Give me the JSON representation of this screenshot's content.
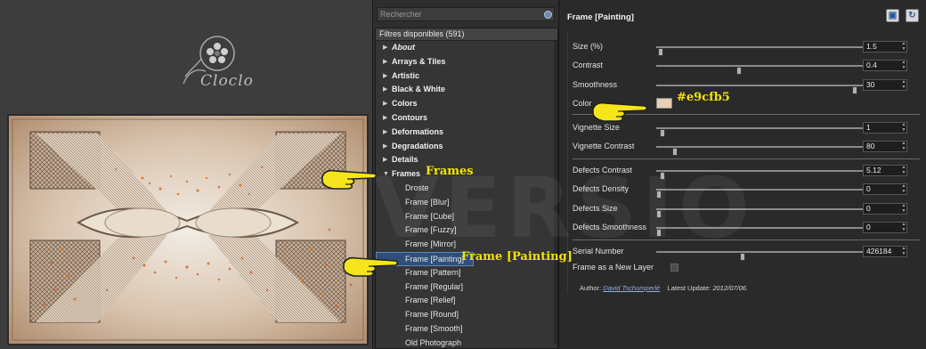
{
  "preview": {
    "logo_text": "Cloclo"
  },
  "filter_list": {
    "search_placeholder": "Rechercher",
    "header": "Filtres disponibles (591)",
    "categories": [
      "About",
      "Arrays & Tiles",
      "Artistic",
      "Black & White",
      "Colors",
      "Contours",
      "Deformations",
      "Degradations",
      "Details",
      "Frames"
    ],
    "frames_items": [
      "Droste",
      "Frame [Blur]",
      "Frame [Cube]",
      "Frame [Fuzzy]",
      "Frame [Mirror]",
      "Frame [Painting]",
      "Frame [Pattern]",
      "Frame [Regular]",
      "Frame [Relief]",
      "Frame [Round]",
      "Frame [Smooth]",
      "Old Photograph"
    ]
  },
  "params": {
    "title": "Frame [Painting]",
    "size": {
      "label": "Size (%)",
      "value": "1.5",
      "slider_fraction": 0.02
    },
    "contrast": {
      "label": "Contrast",
      "value": "0.4",
      "slider_fraction": 0.4
    },
    "smoothness": {
      "label": "Smoothness",
      "value": "30",
      "slider_fraction": 0.96
    },
    "color": {
      "label": "Color",
      "hex": "#e9cfb5"
    },
    "vignette_size": {
      "label": "Vignette Size",
      "value": "1",
      "slider_fraction": 0.03
    },
    "vignette_contrast": {
      "label": "Vignette Contrast",
      "value": "80",
      "slider_fraction": 0.09
    },
    "defects_contrast": {
      "label": "Defects Contrast",
      "value": "5.12",
      "slider_fraction": 0.03
    },
    "defects_density": {
      "label": "Defects Density",
      "value": "0",
      "slider_fraction": 0.0
    },
    "defects_size": {
      "label": "Defects Size",
      "value": "0",
      "slider_fraction": 0.0
    },
    "defects_smoothness": {
      "label": "Defects Smoothness",
      "value": "0",
      "slider_fraction": 0.0
    },
    "serial_number": {
      "label": "Serial Number",
      "value": "426184",
      "slider_fraction": 0.42
    },
    "frame_new_layer": {
      "label": "Frame as a New Layer",
      "checked": false
    },
    "author_label": "Author:",
    "author_name": "David Tschumperlé",
    "latest_update_label": "Latest Update:",
    "latest_update": "2012/07/06."
  },
  "overlay": {
    "watermark": "VERSIO",
    "annot_frames": "Frames",
    "annot_frame_painting": "Frame [Painting]",
    "annot_color": "#e9cfb5"
  },
  "colors": {
    "selection": "#2f4f78",
    "annotation": "#f2e400",
    "hand": "#f5e51a"
  }
}
